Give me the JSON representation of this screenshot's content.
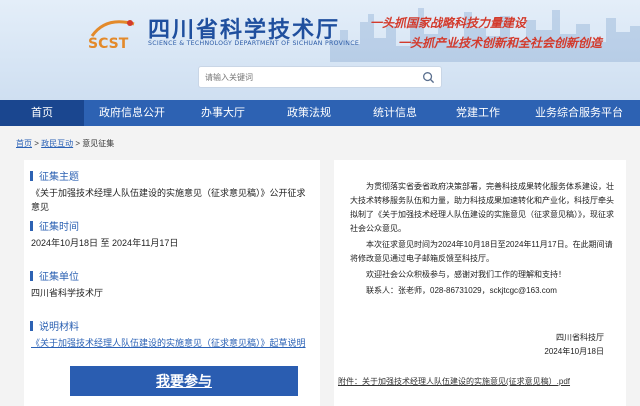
{
  "header": {
    "title": "四川省科学技术厅",
    "subtitle": "SCIENCE & TECHNOLOGY DEPARTMENT OF SICHUAN PROVINCE",
    "logo_text": "SCST",
    "slogan1": "一头抓国家战略科技力量建设",
    "slogan2": "一头抓产业技术创新和全社会创新创造",
    "accent": "#2d62b3",
    "slogan_color": "#d33a2c"
  },
  "search": {
    "placeholder": "请输入关键词"
  },
  "nav": [
    "首页",
    "政府信息公开",
    "办事大厅",
    "政策法规",
    "统计信息",
    "党建工作",
    "业务综合服务平台"
  ],
  "breadcrumb": {
    "home": "首页",
    "sep": ">",
    "level2": "政民互动",
    "current": "意见征集"
  },
  "left": {
    "topic_label": "征集主题",
    "topic": "《关于加强技术经理人队伍建设的实施意见（征求意见稿）》公开征求意见",
    "time_label": "征集时间",
    "time": "2024年10月18日 至 2024年11月17日",
    "unit_label": "征集单位",
    "unit": "四川省科学技术厅",
    "material_label": "说明材料",
    "material": "《关于加强技术经理人队伍建设的实施意见（征求意见稿）》起草说明",
    "button": "我要参与"
  },
  "right": {
    "para1": "为贯彻落实省委省政府决策部署，完善科技成果转化服务体系建设，壮大技术转移服务队伍和力量，助力科技成果加速转化和产业化，科技厅牵头拟制了《关于加强技术经理人队伍建设的实施意见（征求意见稿）》，现征求社会公众意见。",
    "para2": "本次征求意见时间为2024年10月18日至2024年11月17日。在此期间请将修改意见通过电子邮箱反馈至科技厅。",
    "para3": "欢迎社会公众积极参与，感谢对我们工作的理解和支持！",
    "contact": "联系人：张老师，028-86731029，sckjtcgc@163.com",
    "sign_org": "四川省科技厅",
    "sign_date": "2024年10月18日",
    "attachment": "附件：关于加强技术经理人队伍建设的实施意见(征求意见稿）.pdf"
  }
}
